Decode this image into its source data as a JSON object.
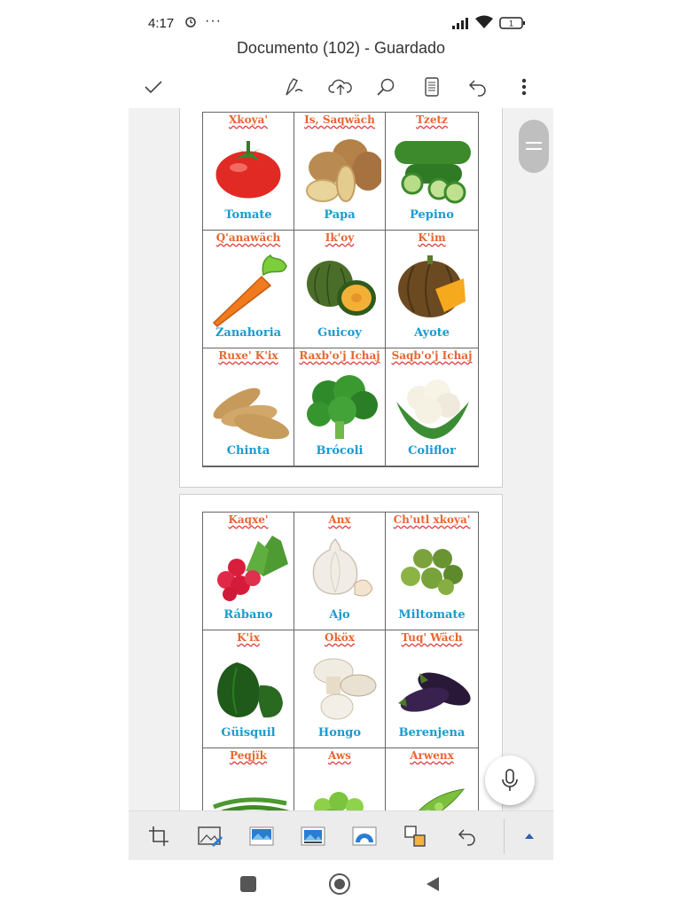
{
  "status": {
    "time": "4:17",
    "dots": "···",
    "battery": "1"
  },
  "app": {
    "title": "Documento (102) - Guardado"
  },
  "page1": {
    "cells": [
      {
        "top": "Xkoya'",
        "bottom": "Tomate",
        "icon": "tomato-image"
      },
      {
        "top": "Is, Saqwäch",
        "bottom": "Papa",
        "icon": "potato-image"
      },
      {
        "top": "Tzetz",
        "bottom": "Pepino",
        "icon": "cucumber-image"
      },
      {
        "top": "Q'anawäch",
        "bottom": "Zanahoria",
        "icon": "carrot-image"
      },
      {
        "top": "Ik'oy",
        "bottom": "Guicoy",
        "icon": "squash-image"
      },
      {
        "top": "K'im",
        "bottom": "Ayote",
        "icon": "pumpkin-image"
      },
      {
        "top": "Ruxe' K'ix",
        "bottom": "Chinta",
        "icon": "sweet-potato-image"
      },
      {
        "top": "Raxb'o'j Ichaj",
        "bottom": "Brócoli",
        "icon": "broccoli-image"
      },
      {
        "top": "Saqb'o'j Ichaj",
        "bottom": "Coliflor",
        "icon": "cauliflower-image"
      }
    ]
  },
  "page2": {
    "cells": [
      {
        "top": "Kaqxe'",
        "bottom": "Rábano",
        "icon": "radish-image"
      },
      {
        "top": "Anx",
        "bottom": "Ajo",
        "icon": "garlic-image"
      },
      {
        "top": "Ch'utl xkoya'",
        "bottom": "Miltomate",
        "icon": "miltomate-image"
      },
      {
        "top": "K'ix",
        "bottom": "Güisquil",
        "icon": "chayote-image"
      },
      {
        "top": "Oköx",
        "bottom": "Hongo",
        "icon": "mushroom-image"
      },
      {
        "top": "Tuq' Wäch",
        "bottom": "Berenjena",
        "icon": "eggplant-image"
      },
      {
        "top": "Peqjïk",
        "bottom": "",
        "icon": "green-beans-image"
      },
      {
        "top": "Aws",
        "bottom": "",
        "icon": "fava-beans-image"
      },
      {
        "top": "Arwenx",
        "bottom": "",
        "icon": "peas-image"
      }
    ]
  }
}
